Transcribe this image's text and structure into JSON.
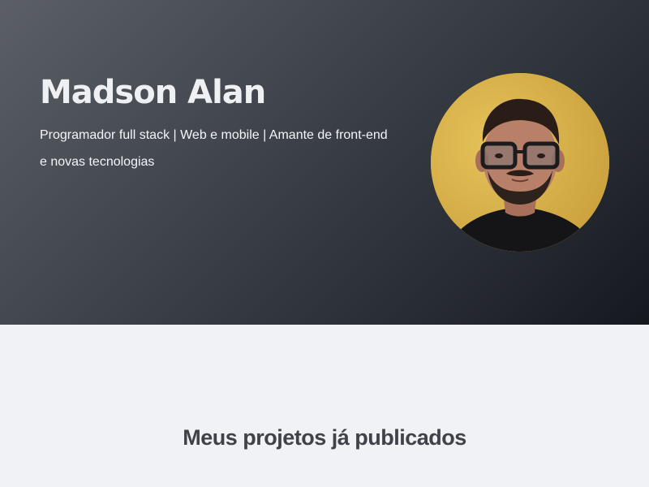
{
  "hero": {
    "name": "Madson Alan",
    "bio": "Programador full stack | Web e mobile | Amante de front-end e novas tecnologias",
    "avatar_icon": "profile-photo",
    "avatar_bg": "#d9b24b"
  },
  "projects": {
    "title": "Meus projetos já publicados"
  }
}
